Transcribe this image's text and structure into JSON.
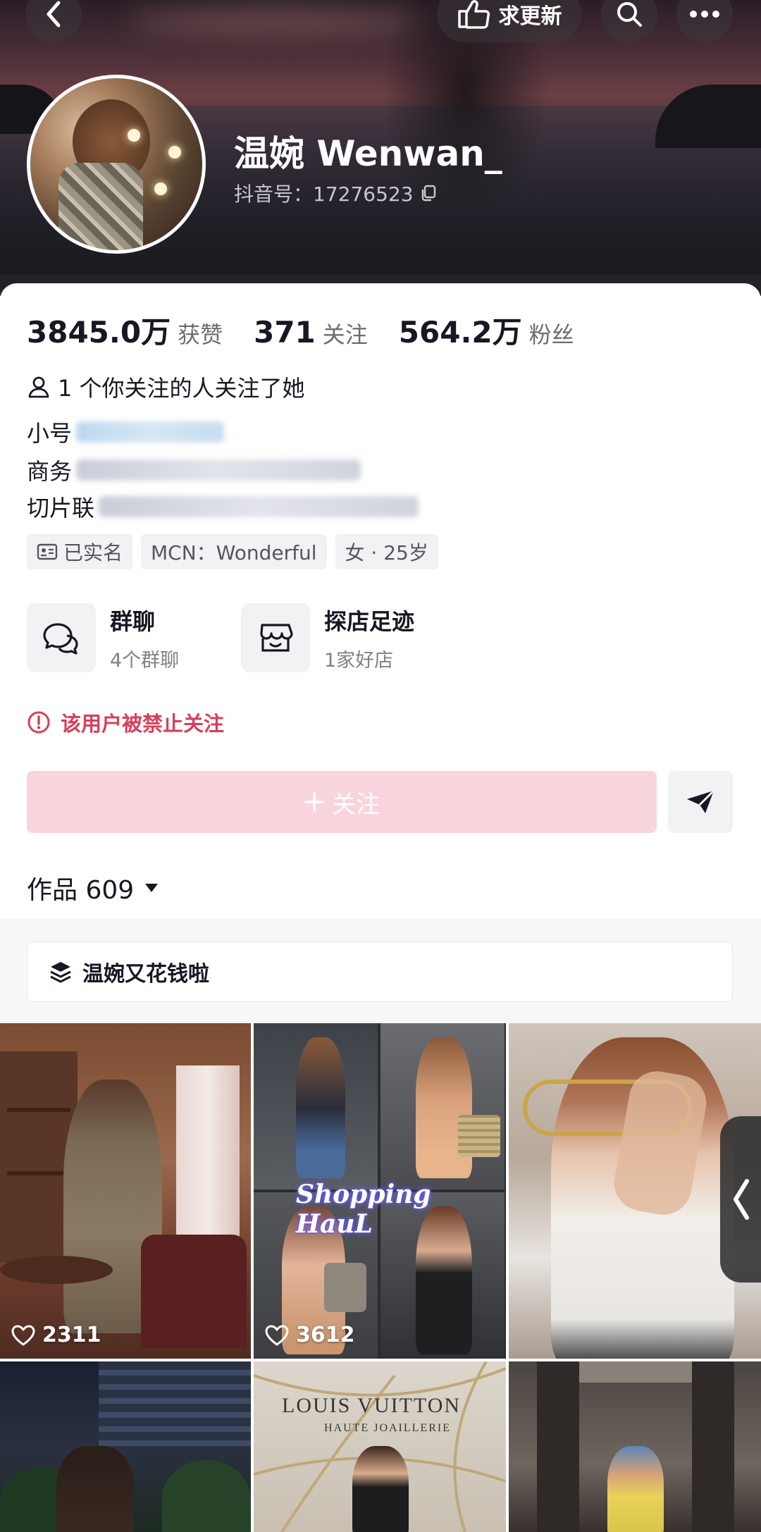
{
  "header": {
    "update_label": "求更新",
    "name": "温婉 Wenwan_",
    "douyin_id": "抖音号：17276523"
  },
  "stats": [
    {
      "value": "3845.0万",
      "label": "获赞"
    },
    {
      "value": "371",
      "label": "关注"
    },
    {
      "value": "564.2万",
      "label": "粉丝"
    }
  ],
  "mutual_follow": "1 个你关注的人关注了她",
  "bio": {
    "line1_label": "小号",
    "line2_label": "商务",
    "line3_label": "切片联"
  },
  "tags": [
    "已实名",
    "MCN：Wonderful",
    "女 · 25岁"
  ],
  "features": [
    {
      "title": "群聊",
      "sub": "4个群聊",
      "icon": "chat-bubbles-icon"
    },
    {
      "title": "探店足迹",
      "sub": "1家好店",
      "icon": "shop-icon"
    }
  ],
  "warning": "该用户被禁止关注",
  "follow_button": "关注",
  "works_tab": "作品 609",
  "collection_title": "温婉又花钱啦",
  "grid": {
    "tiles": [
      {
        "likes": "2311"
      },
      {
        "likes": "3612",
        "overlay_text": "Shopping HauL"
      },
      {
        "likes": ""
      },
      {
        "likes": ""
      },
      {
        "likes": "",
        "overlay_text": "LOUIS VUITTON",
        "overlay_sub": "HAUTE JOAILLERIE"
      },
      {
        "likes": ""
      }
    ]
  },
  "colors": {
    "accent_pink": "#f8d5dc",
    "warning_red": "#d6405a"
  }
}
